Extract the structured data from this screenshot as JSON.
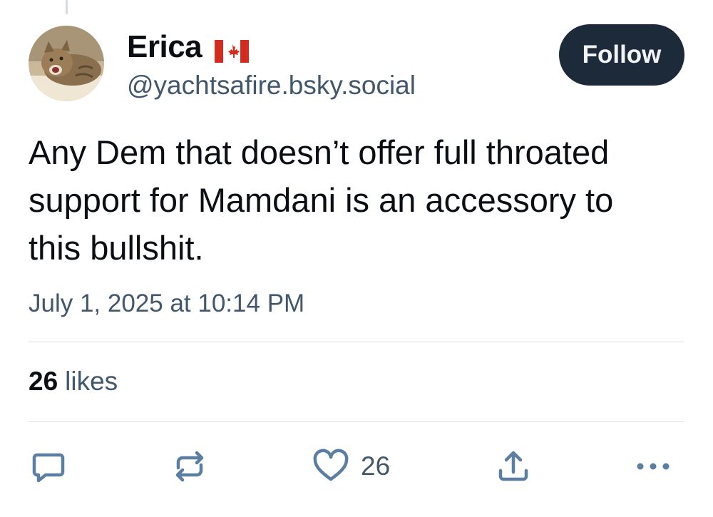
{
  "author": {
    "display_name": "Erica",
    "flag_icon": "canada-flag-icon",
    "handle": "@yachtsafire.bsky.social"
  },
  "follow_button": {
    "label": "Follow"
  },
  "post": {
    "text": "Any Dem that doesn’t offer full throated support for Mamdani is an accessory to this bullshit.",
    "timestamp": "July 1, 2025 at 10:14 PM"
  },
  "stats": {
    "likes_count": "26",
    "likes_label": "likes"
  },
  "actions": {
    "reply_icon": "reply-icon",
    "repost_icon": "repost-icon",
    "like_icon": "heart-icon",
    "like_count": "26",
    "share_icon": "share-icon",
    "more_icon": "more-icon"
  },
  "colors": {
    "text_primary": "#0b0f14",
    "text_secondary": "#42576c",
    "follow_bg": "#1d2a3a",
    "icon_color": "#5b7fa3"
  }
}
